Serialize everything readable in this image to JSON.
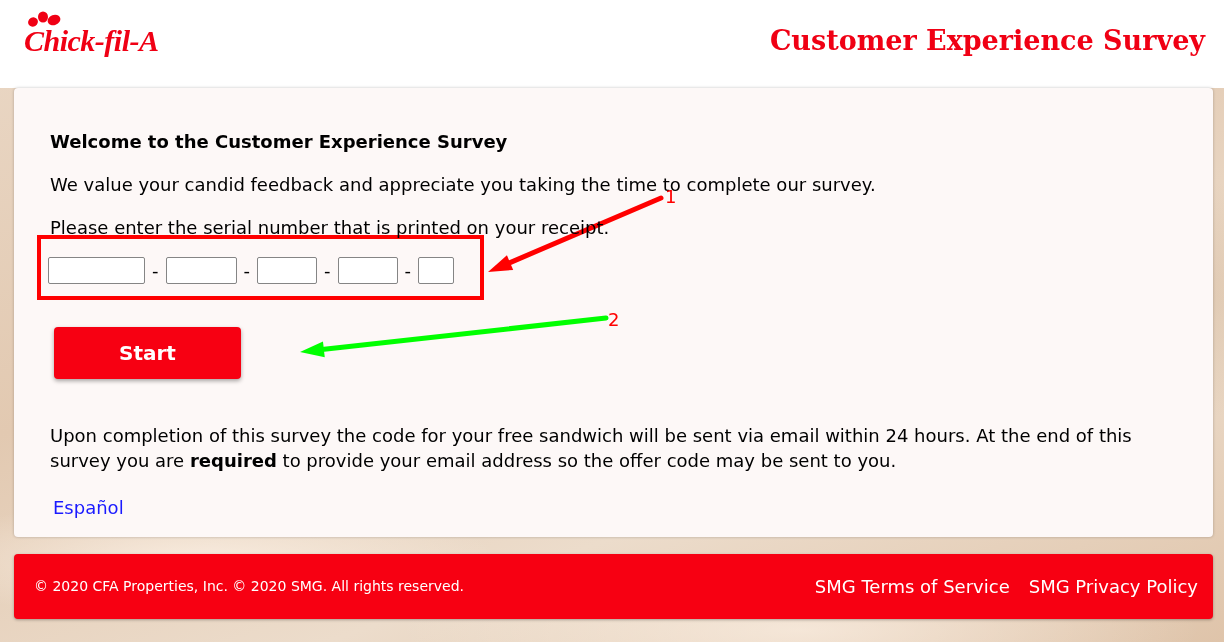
{
  "header": {
    "logo": "Chick-fil-A",
    "title": "Customer Experience Survey"
  },
  "survey": {
    "heading": "Welcome to the Customer Experience Survey",
    "intro": "We value your candid feedback and appreciate you taking the time to complete our survey.",
    "serial_prompt": "Please enter the serial number that is printed on your receipt.",
    "serial_fields": [
      {
        "kind": "field",
        "separator": "-"
      },
      {
        "kind": "field",
        "separator": "-"
      },
      {
        "kind": "field",
        "separator": "-"
      },
      {
        "kind": "field",
        "separator": "-"
      },
      {
        "kind": "field"
      }
    ],
    "start_button": "Start",
    "notice": "Upon completion of this survey the code for your free sandwich will be sent via email within 24 hours. At the end of this survey you are **required** to provide your email address so the offer code may be sent to you.",
    "language_link": "Español"
  },
  "annotations": [
    {
      "label": "1",
      "color": "#ff0000"
    },
    {
      "label": "2",
      "color": "#00ff00"
    }
  ],
  "footer": {
    "copyright": "© 2020 CFA Properties, Inc. © 2020 SMG. All rights reserved.",
    "links": [
      "SMG Terms of Service",
      "SMG Privacy Policy"
    ]
  }
}
